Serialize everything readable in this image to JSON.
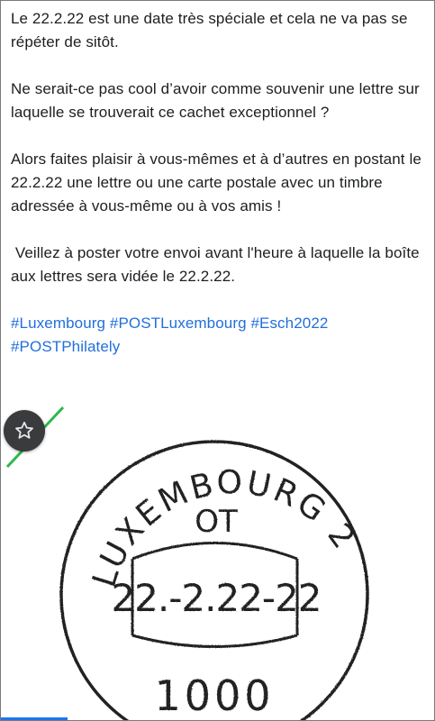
{
  "post": {
    "paragraphs": [
      "Le 22.2.22 est une date très spéciale et cela ne va pas se répéter de sitôt.",
      "Ne serait-ce pas cool d’avoir comme souvenir une lettre sur laquelle se trouverait ce cachet exceptionnel ?",
      "Alors faites plaisir à vous-mêmes et à d’autres en postant le 22.2.22 une lettre ou une carte postale avec un timbre adressée à vous-même ou à vos amis !",
      " Veillez à poster votre envoi avant l'heure à laquelle la boîte aux lettres sera vidée le 22.2.22."
    ],
    "hashtags": [
      "#Luxembourg",
      "#POSTLuxembourg",
      "#Esch2022",
      "#POSTPhilately"
    ]
  },
  "stamp": {
    "ring_text": "LUXEMBOURG 2",
    "code": "OT",
    "date": "22.-2.22-22",
    "postal_code": "1000"
  },
  "icons": {
    "favorite": "star-icon"
  },
  "colors": {
    "link": "#216fdb",
    "accent": "#1877f2",
    "badge": "#3a3b3c",
    "green_edge": "#2db84b"
  }
}
